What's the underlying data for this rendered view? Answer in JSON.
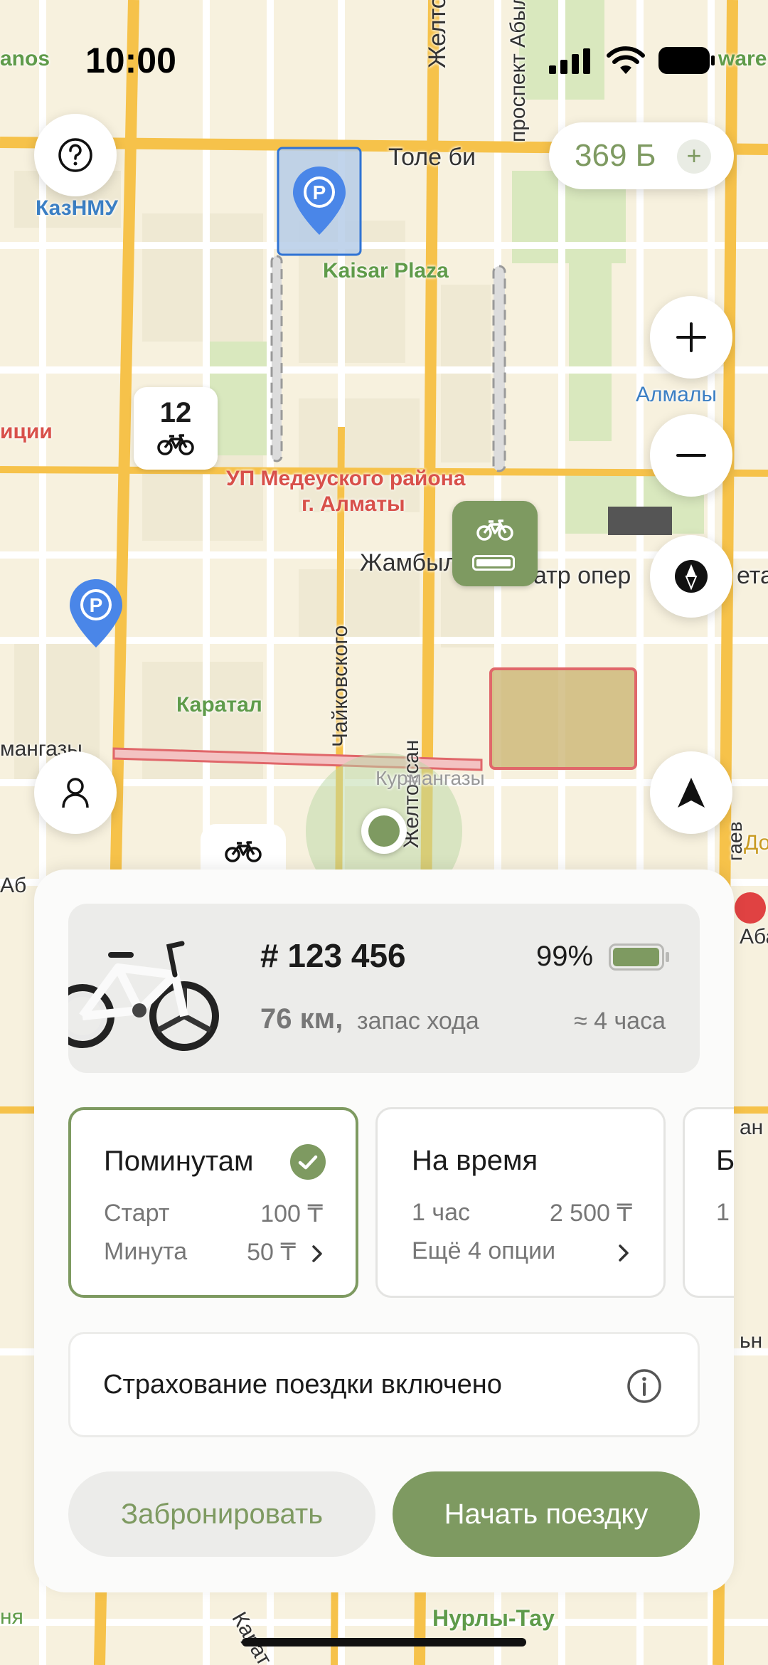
{
  "status_bar": {
    "time": "10:00"
  },
  "map": {
    "labels": {
      "tole_bi": "Толе би",
      "zheltoksan_top": "Желтоксан",
      "prospekt": "проспект Абылай",
      "kaznmu": "КазНМУ",
      "kaisar_plaza": "Kaisar Plaza",
      "almaly": "Алмалы",
      "police": "иции",
      "up_line1": "УП Медеуского района",
      "up_line2": "г. Алматы",
      "zhambyla": "Жамбыла",
      "theatre": "атр опер",
      "eta": "ета",
      "karatal": "Каратал",
      "chaikovskogo": "Чайковского",
      "zheltoksan_bottom": "Желтоксан",
      "kurmangazy": "Курмангазы",
      "mangazy_left": "мангазы",
      "abylay": "Абылай",
      "dom": "Дом",
      "gaev": "гаев",
      "anos": "anos",
      "ware": "ware",
      "nurly_tau": "Нурлы-Тау",
      "karat": "Карат",
      "ab_right": "Аба",
      "ab_left": "Аб",
      "an_right": "ан",
      "ni_right": "ьн",
      "nya": "ня"
    },
    "bike_cluster": {
      "count": "12"
    },
    "parking_label": "P"
  },
  "top": {
    "balance": "369 Б",
    "balance_add": "+"
  },
  "bike": {
    "id": "# 123 456",
    "battery_percent": "99%",
    "battery_level": 0.99,
    "range_value": "76 км,",
    "range_label": "запас хода",
    "time_estimate": "≈ 4 часа"
  },
  "plans": [
    {
      "title": "Поминутам",
      "row1_label": "Старт",
      "row1_value": "100 ₸",
      "row2_label": "Минута",
      "row2_value": "50 ₸",
      "selected": true
    },
    {
      "title": "На время",
      "row1_label": "1 час",
      "row1_value": "2 500 ₸",
      "row2_label": "Ещё 4 опции",
      "row2_value": "",
      "selected": false
    },
    {
      "title": "Б",
      "row1_label": "1",
      "selected": false
    }
  ],
  "insurance": {
    "text": "Страхование поездки включено"
  },
  "actions": {
    "reserve": "Забронировать",
    "start": "Начать поездку"
  },
  "colors": {
    "accent": "#7e9a61",
    "accent_light": "#e9ece4",
    "zone_red": "#e0676a",
    "zone_blue": "#4a86d8"
  }
}
